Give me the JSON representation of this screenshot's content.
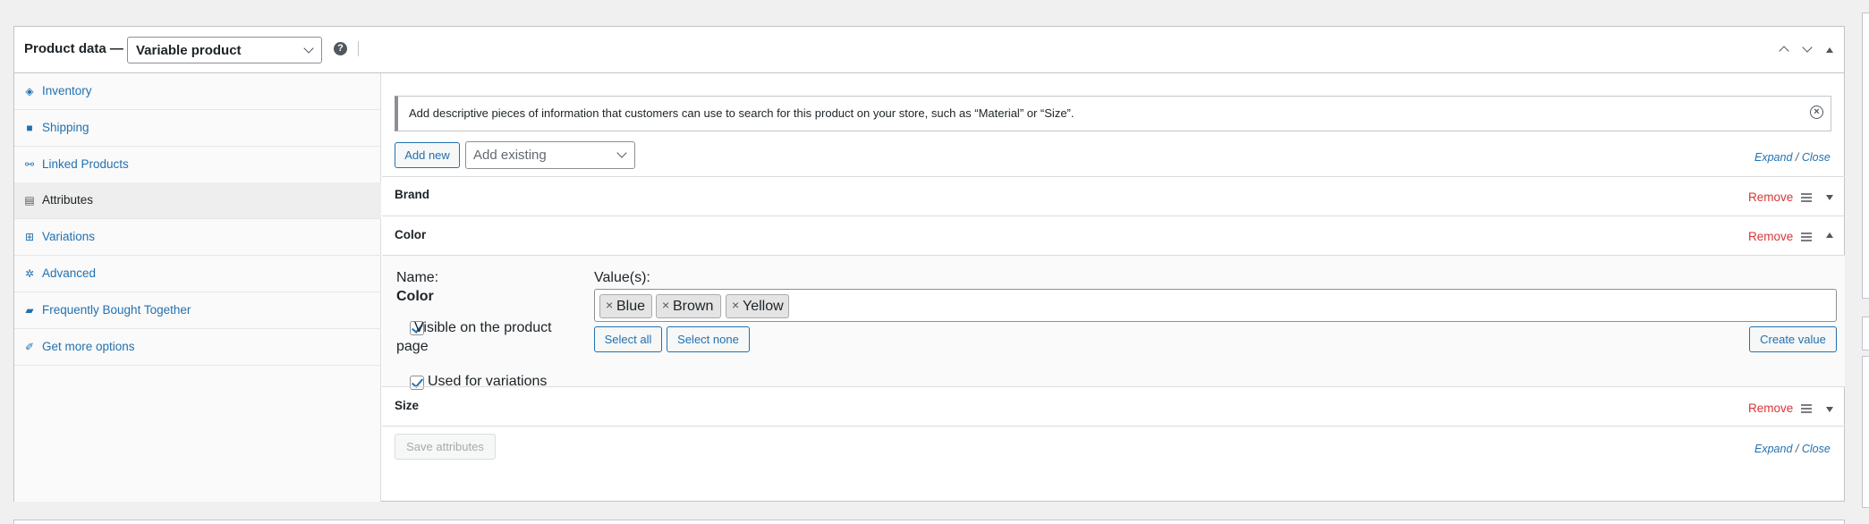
{
  "header": {
    "title": "Product data —",
    "product_type": "Variable product",
    "help_icon": "?"
  },
  "tabs": [
    {
      "label": "Inventory",
      "icon": "tag-icon"
    },
    {
      "label": "Shipping",
      "icon": "truck-icon"
    },
    {
      "label": "Linked Products",
      "icon": "link-icon"
    },
    {
      "label": "Attributes",
      "icon": "list-icon",
      "active": true
    },
    {
      "label": "Variations",
      "icon": "grid-icon"
    },
    {
      "label": "Advanced",
      "icon": "gear-icon"
    },
    {
      "label": "Frequently Bought Together",
      "icon": "lock-icon"
    },
    {
      "label": "Get more options",
      "icon": "plugin-icon"
    }
  ],
  "notice": {
    "text": "Add descriptive pieces of information that customers can use to search for this product on your store, such as “Material” or “Size”.",
    "dismiss": "×"
  },
  "toolbar": {
    "add_new": "Add new",
    "add_existing_placeholder": "Add existing",
    "expand": "Expand",
    "slash": " / ",
    "close": "Close"
  },
  "attributes": [
    {
      "name": "Brand",
      "remove": "Remove"
    },
    {
      "name": "Color",
      "remove": "Remove"
    },
    {
      "name": "Size",
      "remove": "Remove"
    }
  ],
  "color_detail": {
    "name_label": "Name:",
    "name_value": "Color",
    "values_label": "Value(s):",
    "values": [
      "Blue",
      "Brown",
      "Yellow"
    ],
    "chip_remove": "×",
    "visible_label": "Visible on the product page",
    "variations_label": "Used for variations",
    "select_all": "Select all",
    "select_none": "Select none",
    "create_value": "Create value"
  },
  "footer": {
    "save": "Save attributes"
  },
  "colors": {
    "link": "#2271b1",
    "remove": "#d63638"
  }
}
